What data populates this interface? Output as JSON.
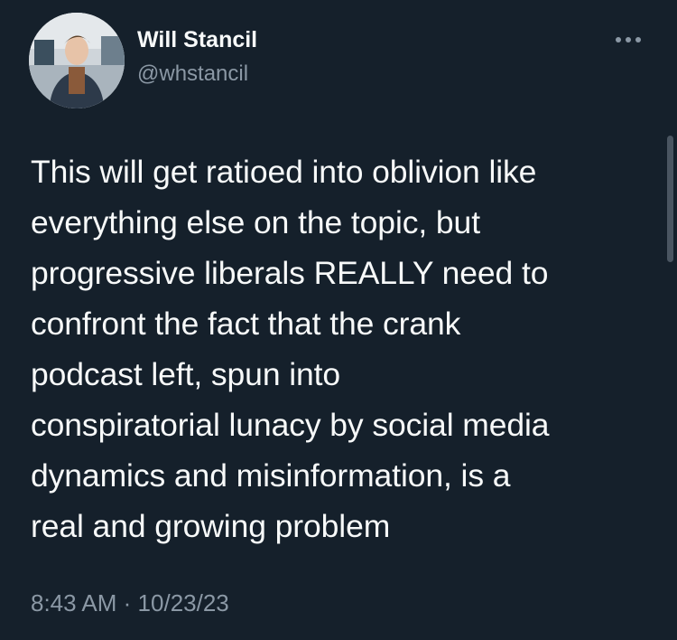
{
  "author": {
    "display_name": "Will Stancil",
    "handle": "@whstancil",
    "avatar_icon": "avatar-photo"
  },
  "menu": {
    "more_icon": "more-options-icon"
  },
  "tweet": {
    "lines": [
      "This will get ratioed into oblivion like",
      "everything else on the topic, but",
      "progressive liberals REALLY need to",
      "confront the fact that the crank",
      "podcast left, spun into",
      "conspiratorial lunacy by social media",
      "dynamics and misinformation, is a",
      "real and growing problem"
    ],
    "time": "8:43 AM",
    "separator": "·",
    "date": "10/23/23"
  },
  "colors": {
    "background": "#15202b",
    "text": "#f7f9f9",
    "secondary": "#8b98a5"
  }
}
